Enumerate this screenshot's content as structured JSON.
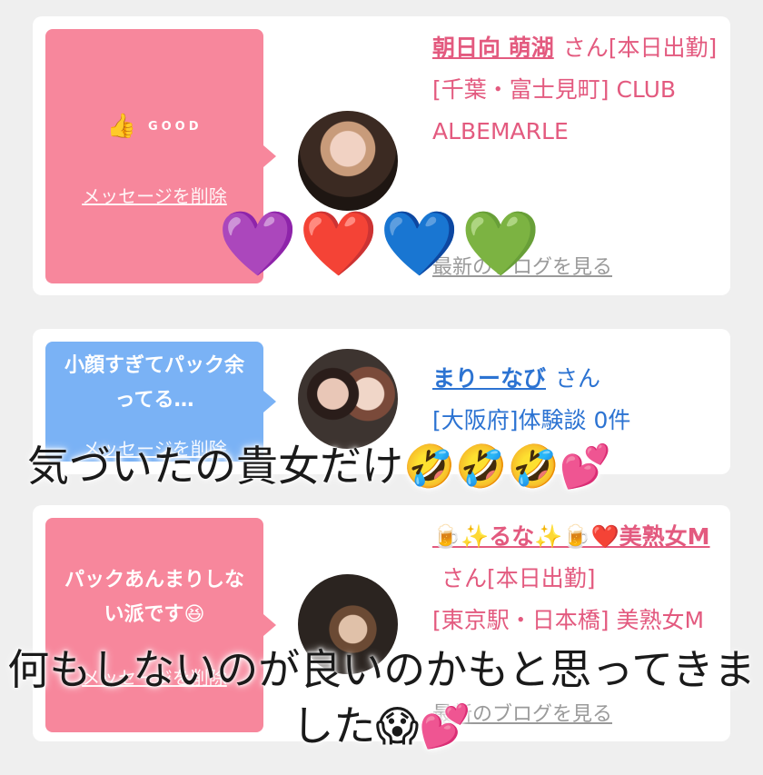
{
  "cards": [
    {
      "bubble_message": "",
      "reaction": {
        "icon": "thumbs-up-icon",
        "label": "GOOD"
      },
      "delete_label": "メッセージを削除",
      "name": "朝日向 萌湖",
      "honorific": "さん",
      "detail_line1": "[本日出勤]",
      "detail_line2": "[千葉・富士見町] CLUB ALBEMARLE",
      "blog_link": "最新のブログを見る"
    },
    {
      "bubble_message": "小顔すぎてパック余ってる…",
      "delete_label": "メッセージを削除",
      "name": "まりーなび",
      "honorific": "さん",
      "detail_line1": "[大阪府]体験談 0件"
    },
    {
      "bubble_message": "パックあんまりしない派です😆",
      "delete_label": "メッセージを削除",
      "name": "🍺✨るな✨🍺❤️美熟女M",
      "honorific": "さん[本日出勤]",
      "detail_line1": "[東京駅・日本橋] 美熟女M",
      "blog_link": "最新のブログを見る"
    }
  ],
  "hearts": "💜❤️💙💚",
  "captions": {
    "caption1": "気づいたの貴女だけ🤣🤣🤣💕",
    "caption2": "何もしないのが良いのかもと思ってきました😱💕"
  },
  "colors": {
    "pink": "#f7879c",
    "blue": "#7ab2f5",
    "name_pink": "#e35a7f",
    "name_blue": "#2c73d2"
  }
}
